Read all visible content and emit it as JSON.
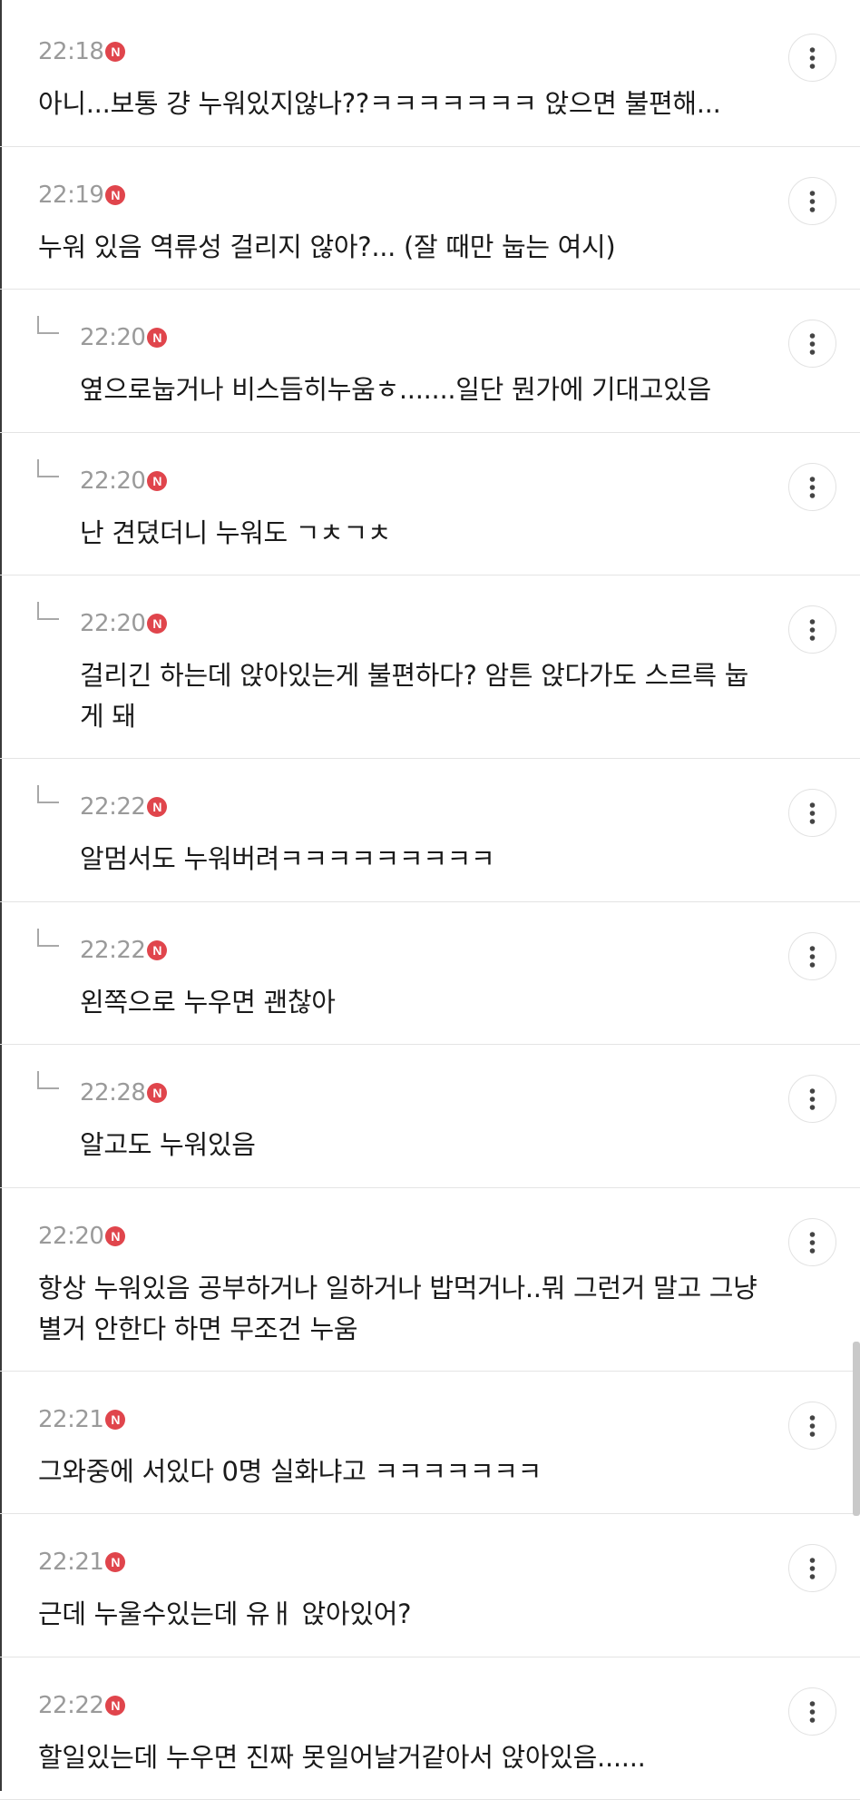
{
  "comments": [
    {
      "time": "22:18",
      "badge": "N",
      "reply": false,
      "text": "아니...보통 걍 누워있지않나??ㅋㅋㅋㅋㅋㅋㅋ 앉으면 불편해..."
    },
    {
      "time": "22:19",
      "badge": "N",
      "reply": false,
      "text": "누워 있음 역류성 걸리지 않아?... (잘 때만 눕는 여시)"
    },
    {
      "time": "22:20",
      "badge": "N",
      "reply": true,
      "text": "옆으로눕거나 비스듬히누움ㅎ.......일단 뭔가에 기대고있음"
    },
    {
      "time": "22:20",
      "badge": "N",
      "reply": true,
      "text": "난 견뎠더니 누워도 ㄱㅊㄱㅊ"
    },
    {
      "time": "22:20",
      "badge": "N",
      "reply": true,
      "text": "걸리긴 하는데 앉아있는게 불편하다? 암튼 앉다가도 스르륵 눕게 돼"
    },
    {
      "time": "22:22",
      "badge": "N",
      "reply": true,
      "text": "알멈서도 누워버려ㅋㅋㅋㅋㅋㅋㅋㅋㅋ"
    },
    {
      "time": "22:22",
      "badge": "N",
      "reply": true,
      "text": "왼쪽으로 누우면 괜찮아"
    },
    {
      "time": "22:28",
      "badge": "N",
      "reply": true,
      "text": "알고도 누워있음"
    },
    {
      "time": "22:20",
      "badge": "N",
      "reply": false,
      "text": "항상 누워있음 공부하거나 일하거나 밥먹거나..뭐 그런거 말고 그냥 별거 안한다 하면 무조건 누움"
    },
    {
      "time": "22:21",
      "badge": "N",
      "reply": false,
      "text": "그와중에 서있다 0명 실화냐고 ㅋㅋㅋㅋㅋㅋㅋ"
    },
    {
      "time": "22:21",
      "badge": "N",
      "reply": false,
      "text": "근데 누울수있는데 유ㅐ 앉아있어?"
    },
    {
      "time": "22:22",
      "badge": "N",
      "reply": false,
      "text": "할일있는데 누우면 진짜 못일어날거같아서 앉아있음......"
    }
  ]
}
